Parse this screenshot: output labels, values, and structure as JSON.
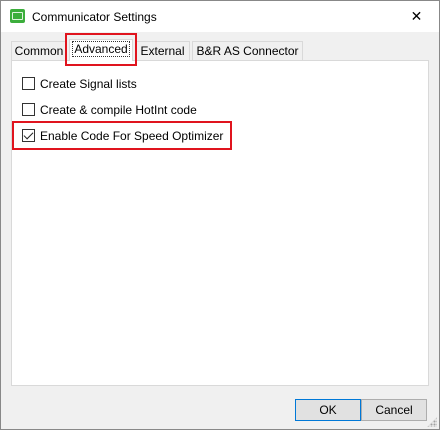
{
  "window": {
    "title": "Communicator Settings",
    "close_glyph": "✕",
    "icon": "app-icon"
  },
  "tabs": [
    {
      "label": "Common",
      "active": false
    },
    {
      "label": "Advanced",
      "active": true
    },
    {
      "label": "External",
      "active": false
    },
    {
      "label": "B&R AS Connector",
      "active": false
    }
  ],
  "options": [
    {
      "label": "Create Signal lists",
      "checked": false
    },
    {
      "label": "Create & compile HotInt code",
      "checked": false
    },
    {
      "label": "Enable Code For Speed Optimizer",
      "checked": true
    }
  ],
  "buttons": {
    "ok": "OK",
    "cancel": "Cancel"
  },
  "colors": {
    "highlight": "#e0141e",
    "app_icon": "#3cae3c"
  }
}
